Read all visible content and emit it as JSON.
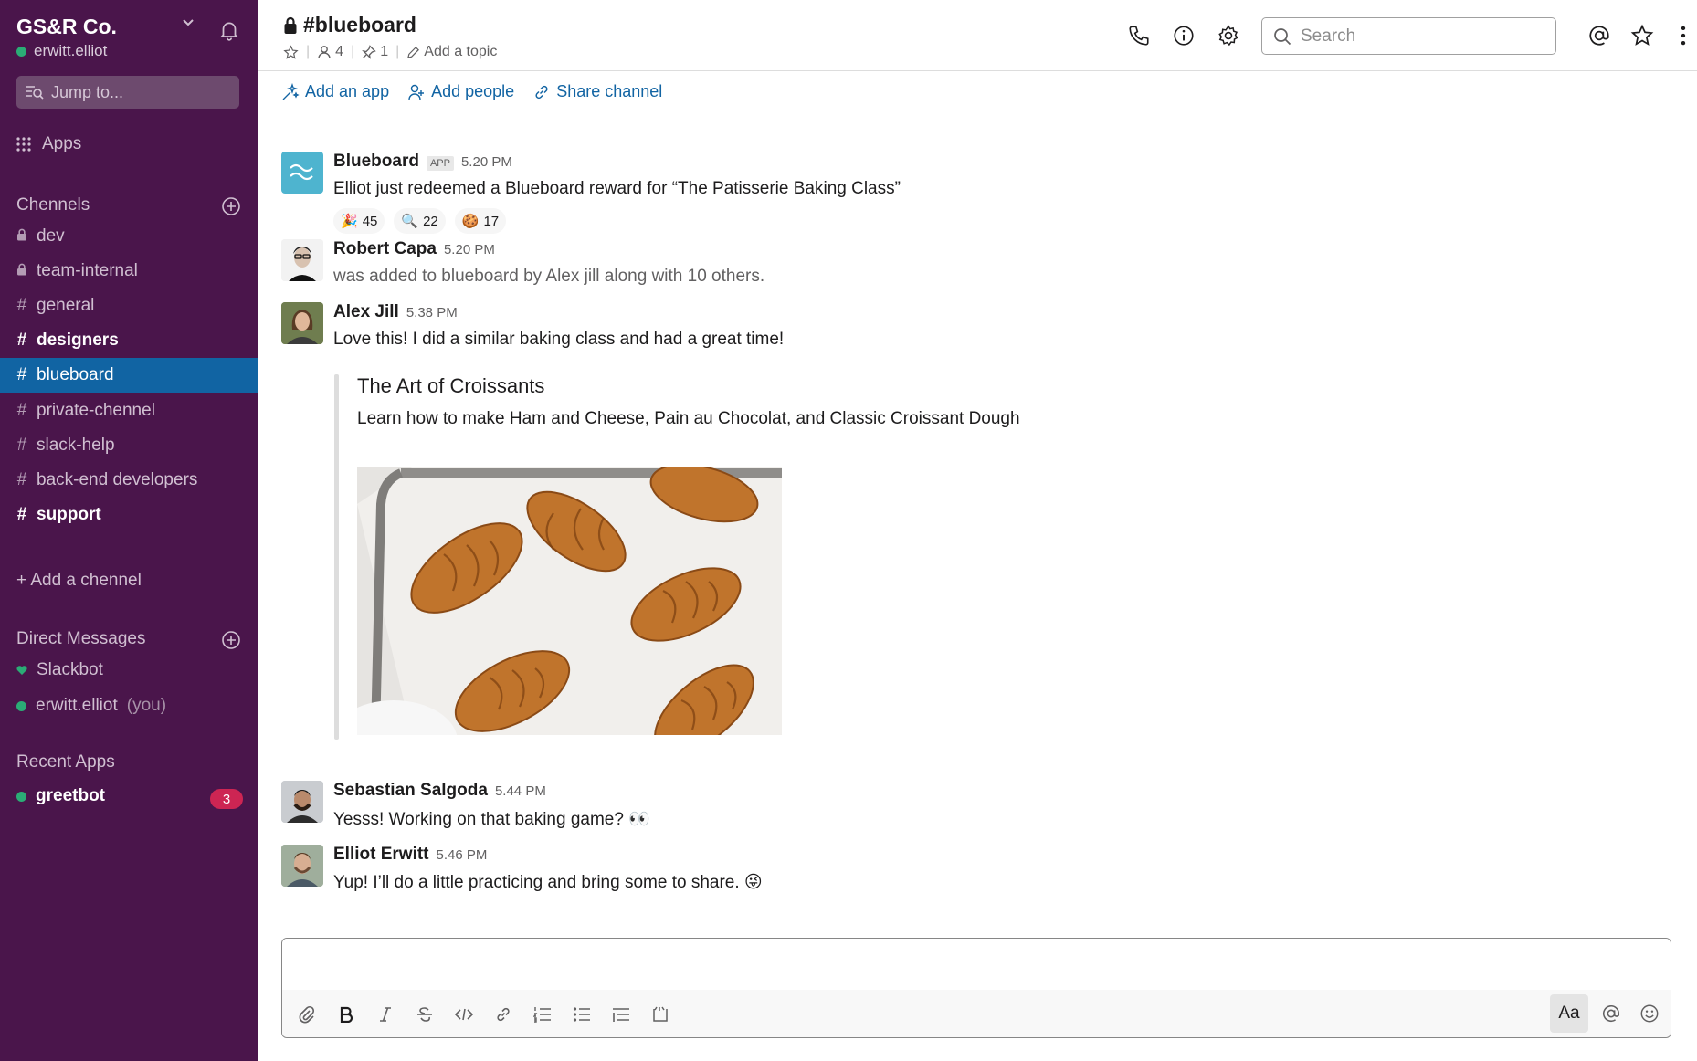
{
  "colors": {
    "sidebar_bg": "#4a154b",
    "active_channel": "#1164a3",
    "link": "#1264a3",
    "online": "#2bac76",
    "badge": "#cd2553"
  },
  "sidebar": {
    "workspace_name": "GS&R Co.",
    "user_name": "erwitt.elliot",
    "jump_placeholder": "Jump to...",
    "apps_label": "Apps",
    "channels_header": "Chennels",
    "channels": [
      {
        "name": "dev",
        "prefix": "lock",
        "bold": false,
        "active": false
      },
      {
        "name": "team-internal",
        "prefix": "lock",
        "bold": false,
        "active": false
      },
      {
        "name": "general",
        "prefix": "#",
        "bold": false,
        "active": false
      },
      {
        "name": "designers",
        "prefix": "#",
        "bold": true,
        "active": false
      },
      {
        "name": "blueboard",
        "prefix": "#",
        "bold": false,
        "active": true
      },
      {
        "name": "private-chennel",
        "prefix": "#",
        "bold": false,
        "active": false
      },
      {
        "name": "slack-help",
        "prefix": "#",
        "bold": false,
        "active": false
      },
      {
        "name": "back-end developers",
        "prefix": "#",
        "bold": false,
        "active": false
      },
      {
        "name": "support",
        "prefix": "#",
        "bold": true,
        "active": false
      }
    ],
    "add_channel_label": "+ Add a chennel",
    "dm_header": "Direct Messages",
    "dms": [
      {
        "name": "Slackbot",
        "suffix": ""
      },
      {
        "name": "erwitt.elliot",
        "suffix": "(you)"
      }
    ],
    "recent_apps_header": "Recent Apps",
    "recent_apps": [
      {
        "name": "greetbot",
        "badge": "3"
      }
    ]
  },
  "header": {
    "channel_name": "#blueboard",
    "member_count": "4",
    "pinned_count": "1",
    "add_topic_label": "Add a topic",
    "search_placeholder": "Search"
  },
  "actions": {
    "add_app": "Add an app",
    "add_people": "Add people",
    "share_channel": "Share channel"
  },
  "messages": [
    {
      "author": "Blueboard",
      "app_tag": "APP",
      "time": "5.20 PM",
      "text": "Elliot just redeemed a Blueboard reward for “The Patisserie Baking Class”",
      "reactions": [
        {
          "emoji": "🎉",
          "count": "45"
        },
        {
          "emoji": "🔍",
          "count": "22"
        },
        {
          "emoji": "🍪",
          "count": "17"
        }
      ]
    },
    {
      "author": "Robert Capa",
      "time": "5.20 PM",
      "text": "was added to blueboard by Alex jill along with 10 others."
    },
    {
      "author": "Alex Jill",
      "time": "5.38 PM",
      "text": "Love this! I did a similar baking class and had a great time!",
      "attachment": {
        "title": "The Art of Croissants",
        "description": "Learn how to make Ham and Cheese, Pain au Chocolat, and Classic Croissant Dough"
      }
    },
    {
      "author": "Sebastian Salgoda",
      "time": "5.44 PM",
      "text": "Yesss! Working on that baking game? 👀"
    },
    {
      "author": "Elliot Erwitt",
      "time": "5.46 PM",
      "text": "Yup! I’ll do a little practicing and bring some to share. 😜"
    }
  ],
  "composer": {
    "format_label": "Aa"
  }
}
